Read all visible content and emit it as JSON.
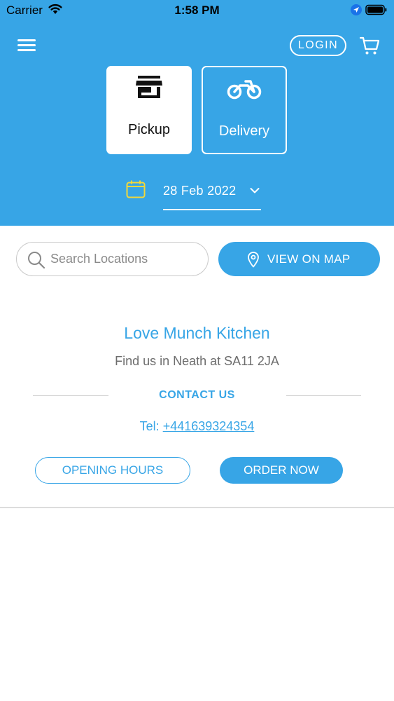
{
  "status_bar": {
    "carrier": "Carrier",
    "time": "1:58 PM"
  },
  "header": {
    "login_label": "LOGIN",
    "modes": [
      {
        "label": "Pickup",
        "selected": true
      },
      {
        "label": "Delivery",
        "selected": false
      }
    ],
    "date": "28 Feb 2022"
  },
  "search": {
    "placeholder": "Search Locations",
    "map_button_label": "VIEW ON MAP"
  },
  "location": {
    "name": "Love Munch Kitchen",
    "address": "Find us in Neath at SA11 2JA",
    "contact_heading": "CONTACT US",
    "tel_label": "Tel: ",
    "tel_number": "+441639324354",
    "opening_hours_label": "OPENING HOURS",
    "order_now_label": "ORDER NOW"
  },
  "colors": {
    "primary": "#37a5e6",
    "calendar_accent": "#f2d83a",
    "text_gray": "#6d6d6d"
  },
  "icons": [
    "wifi-icon",
    "location-arrow-icon",
    "battery-icon",
    "menu-icon",
    "cart-icon",
    "store-icon",
    "motorcycle-icon",
    "calendar-icon",
    "chevron-down-icon",
    "search-icon",
    "map-pin-icon"
  ]
}
